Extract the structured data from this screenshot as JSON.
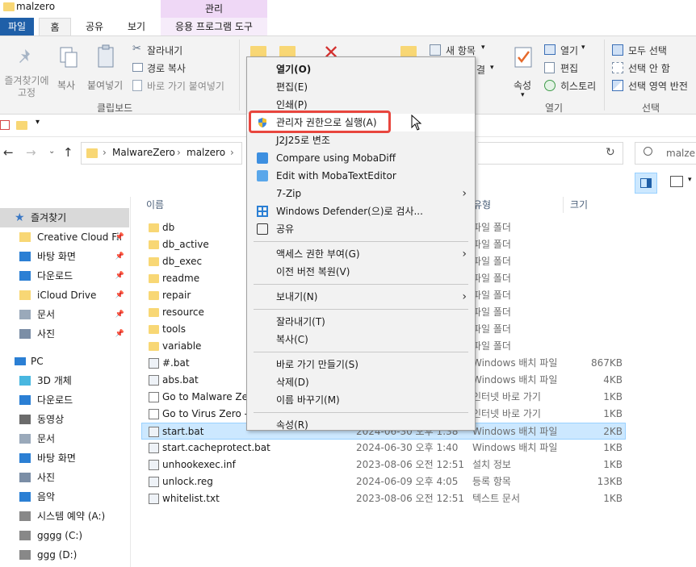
{
  "window": {
    "title": "malzero"
  },
  "ribbon": {
    "manage_header": "관리",
    "tabs": [
      "파일",
      "홈",
      "공유",
      "보기",
      "응용 프로그램 도구"
    ],
    "clipboard": {
      "pin": "즐겨찾기에\n고정",
      "copy": "복사",
      "paste": "붙여넣기",
      "cut": "잘라내기",
      "copy_path": "경로 복사",
      "paste_shortcut": "바로 가기 붙여넣기",
      "group": "클립보드"
    },
    "new_item": "새 항목",
    "open_group": {
      "properties": "속성",
      "open": "열기",
      "edit": "편집",
      "history": "히스토리",
      "group": "열기"
    },
    "select_group": {
      "select_all": "모두 선택",
      "select_none": "선택 안 함",
      "invert": "선택 영역 반전",
      "group": "선택"
    },
    "partial_label": "결"
  },
  "address": {
    "crumbs": [
      "MalwareZero",
      "malzero"
    ],
    "search_placeholder": "malzer"
  },
  "nav": {
    "quick_access": "즐겨찾기",
    "items": [
      {
        "label": "Creative Cloud Fil",
        "pinned": true
      },
      {
        "label": "바탕 화면",
        "pinned": true
      },
      {
        "label": "다운로드",
        "pinned": true
      },
      {
        "label": "iCloud Drive",
        "pinned": true
      },
      {
        "label": "문서",
        "pinned": true
      },
      {
        "label": "사진",
        "pinned": true
      }
    ],
    "pc": "PC",
    "pc_items": [
      "3D 개체",
      "다운로드",
      "동영상",
      "문서",
      "바탕 화면",
      "사진",
      "음악",
      "시스템 예약 (A:)",
      "gggg (C:)",
      "ggg (D:)"
    ]
  },
  "columns": {
    "name": "이름",
    "type": "유형",
    "size": "크기"
  },
  "files": [
    {
      "name": "db",
      "date": "",
      "type": "파일 폴더",
      "size": "",
      "kind": "folder"
    },
    {
      "name": "db_active",
      "date": "",
      "type": "파일 폴더",
      "size": "",
      "kind": "folder"
    },
    {
      "name": "db_exec",
      "date": "",
      "type": "파일 폴더",
      "size": "",
      "kind": "folder"
    },
    {
      "name": "readme",
      "date": "",
      "type": "파일 폴더",
      "size": "",
      "kind": "folder"
    },
    {
      "name": "repair",
      "date": "",
      "type": "파일 폴더",
      "size": "",
      "kind": "folder"
    },
    {
      "name": "resource",
      "date": "",
      "type": "파일 폴더",
      "size": "",
      "kind": "folder"
    },
    {
      "name": "tools",
      "date": "",
      "type": "파일 폴더",
      "size": "",
      "kind": "folder"
    },
    {
      "name": "variable",
      "date": "",
      "type": "파일 폴더",
      "size": "",
      "kind": "folder"
    },
    {
      "name": "#.bat",
      "date": "",
      "type": "Windows 배치 파일",
      "size": "867KB",
      "kind": "bat"
    },
    {
      "name": "abs.bat",
      "date": "",
      "type": "Windows 배치 파일",
      "size": "4KB",
      "kind": "bat"
    },
    {
      "name": "Go to Malware Zero",
      "date": "",
      "type": "인터넷 바로 가기",
      "size": "1KB",
      "kind": "url"
    },
    {
      "name": "Go to Virus Zero - S",
      "date": "",
      "type": "인터넷 바로 가기",
      "size": "1KB",
      "kind": "url"
    },
    {
      "name": "start.bat",
      "date": "2024-06-30 오후 1:38",
      "type": "Windows 배치 파일",
      "size": "2KB",
      "kind": "bat",
      "selected": true
    },
    {
      "name": "start.cacheprotect.bat",
      "date": "2024-06-30 오후 1:40",
      "type": "Windows 배치 파일",
      "size": "1KB",
      "kind": "bat"
    },
    {
      "name": "unhookexec.inf",
      "date": "2023-08-06 오전 12:51",
      "type": "설치 정보",
      "size": "1KB",
      "kind": "inf"
    },
    {
      "name": "unlock.reg",
      "date": "2024-06-09 오후 4:05",
      "type": "등록 항목",
      "size": "13KB",
      "kind": "reg"
    },
    {
      "name": "whitelist.txt",
      "date": "2023-08-06 오전 12:51",
      "type": "텍스트 문서",
      "size": "1KB",
      "kind": "txt"
    }
  ],
  "context_menu": {
    "items": [
      {
        "label": "열기(O)",
        "bold": true
      },
      {
        "label": "편집(E)"
      },
      {
        "label": "인쇄(P)"
      },
      {
        "label": "관리자 권한으로 실행(A)",
        "icon": "shield"
      },
      {
        "label": "J2J25로 변조"
      },
      {
        "label": "Compare using MobaDiff",
        "icon": "mobadiff"
      },
      {
        "label": "Edit with MobaTextEditor",
        "icon": "mobaedit"
      },
      {
        "label": "7-Zip",
        "submenu": true
      },
      {
        "label": "Windows Defender(으)로 검사...",
        "icon": "defender"
      },
      {
        "label": "공유",
        "icon": "share"
      },
      {
        "sep": true
      },
      {
        "label": "액세스 권한 부여(G)",
        "submenu": true
      },
      {
        "label": "이전 버전 복원(V)"
      },
      {
        "sep": true
      },
      {
        "label": "보내기(N)",
        "submenu": true
      },
      {
        "sep": true
      },
      {
        "label": "잘라내기(T)"
      },
      {
        "label": "복사(C)"
      },
      {
        "sep": true
      },
      {
        "label": "바로 가기 만들기(S)"
      },
      {
        "label": "삭제(D)"
      },
      {
        "label": "이름 바꾸기(M)"
      },
      {
        "sep": true
      },
      {
        "label": "속성(R)"
      }
    ]
  }
}
